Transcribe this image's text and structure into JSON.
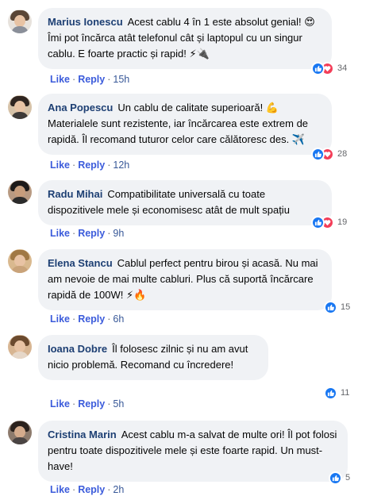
{
  "comments": [
    {
      "author": "Marius Ionescu",
      "text": "Acest cablu 4 în 1 este absolut genial! 😍 Îmi pot încărca atât telefonul cât și laptopul cu un singur cablu. E foarte practic și rapid! ⚡🔌",
      "reaction_count": "34",
      "like_label": "Like",
      "reply_label": "Reply",
      "time": "15h",
      "reactions": [
        "like-icon",
        "love-icon"
      ]
    },
    {
      "author": "Ana Popescu",
      "text": "Un cablu de calitate superioară! 💪 Materialele sunt rezistente, iar încărcarea este extrem de rapidă. Îl recomand tuturor celor care călătoresc des. ✈️",
      "reaction_count": "28",
      "like_label": "Like",
      "reply_label": "Reply",
      "time": "12h",
      "reactions": [
        "like-icon",
        "love-icon"
      ]
    },
    {
      "author": "Radu Mihai",
      "text": "Compatibilitate universală cu toate dispozitivele mele și economisesc atât de mult spațiu",
      "reaction_count": "19",
      "like_label": "Like",
      "reply_label": "Reply",
      "time": "9h",
      "reactions": [
        "like-icon",
        "love-icon"
      ]
    },
    {
      "author": "Elena Stancu",
      "text": "Cablul perfect pentru birou și acasă. Nu mai am nevoie de mai multe cabluri. Plus că suportă încărcare rapidă de 100W! ⚡🔥",
      "reaction_count": "15",
      "like_label": "Like",
      "reply_label": "Reply",
      "time": "6h",
      "reactions": [
        "like-icon"
      ]
    },
    {
      "author": "Ioana Dobre",
      "text": "Îl folosesc zilnic și nu am avut nicio problemă. Recomand cu încredere!",
      "reaction_count": "11",
      "like_label": "Like",
      "reply_label": "Reply",
      "time": "5h",
      "reactions": [
        "like-icon"
      ]
    },
    {
      "author": "Cristina Marin",
      "text": "Acest cablu m-a salvat de multe ori! Îl pot folosi pentru toate dispozitivele mele și este foarte rapid. Un must-have!",
      "reaction_count": "5",
      "like_label": "Like",
      "reply_label": "Reply",
      "time": "2h",
      "reactions": [
        "like-icon"
      ]
    }
  ],
  "colors": {
    "bubble": "#f0f2f5",
    "author": "#1d3f73",
    "link": "#385898",
    "like": "#1877f2",
    "love": "#f33e58"
  }
}
